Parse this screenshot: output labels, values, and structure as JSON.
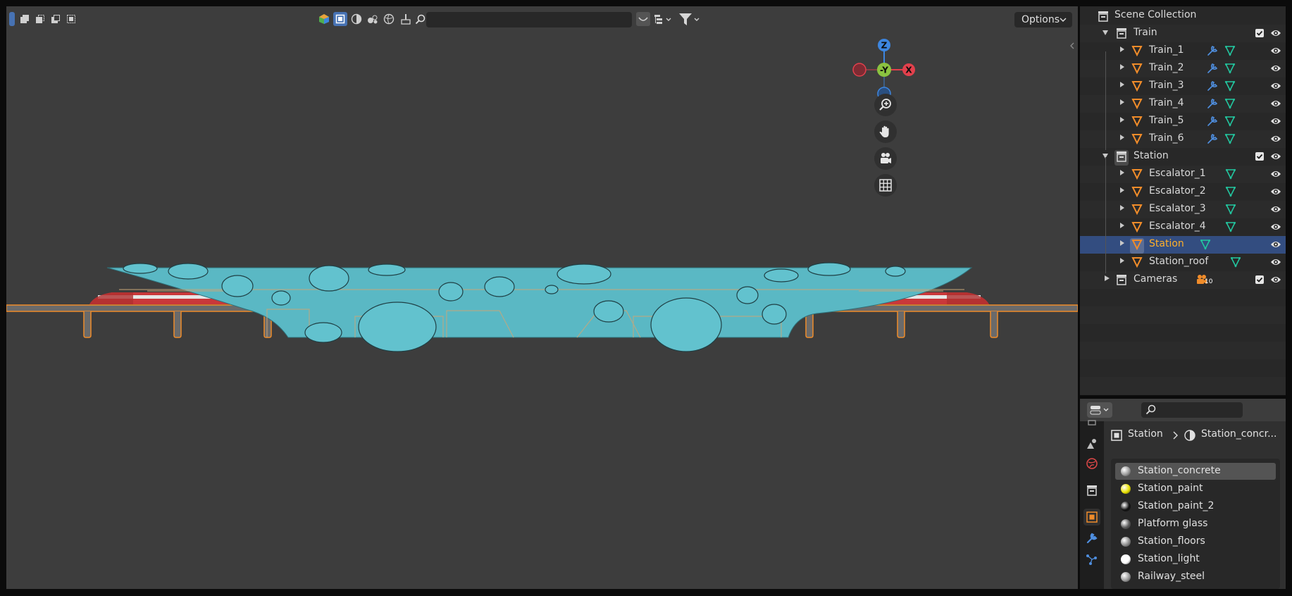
{
  "viewport": {
    "header": {
      "options_label": "Options",
      "icons": [
        "select-box-icon",
        "mode-set-icon",
        "mode-extend-icon",
        "mode-subtract-icon",
        "mode-intersect-icon",
        "object-type-visibility-icon",
        "restrict-select-icon",
        "viewport-shading-icon",
        "render-shading-icon",
        "world-shading-icon",
        "paint-icon",
        "search-icon",
        "curve-icon",
        "hierarchy-icon",
        "filter-icon"
      ]
    },
    "navigation_gizmo": {
      "axis_z": "Z",
      "axis_neg_y": "-Y",
      "axis_x": "X",
      "colors": {
        "x": "#e2404c",
        "y": "#8bc340",
        "z": "#3d86e0"
      }
    },
    "nav_buttons": [
      "zoom-icon",
      "pan-hand-icon",
      "camera-view-icon",
      "ortho-grid-icon"
    ]
  },
  "outliner": {
    "scene_collection": "Scene Collection",
    "rows": [
      {
        "label": "Train",
        "kind": "collection",
        "depth": 1,
        "expanded": true
      },
      {
        "label": "Train_1",
        "kind": "mesh",
        "depth": 2,
        "modifier": true
      },
      {
        "label": "Train_2",
        "kind": "mesh",
        "depth": 2,
        "modifier": true
      },
      {
        "label": "Train_3",
        "kind": "mesh",
        "depth": 2,
        "modifier": true
      },
      {
        "label": "Train_4",
        "kind": "mesh",
        "depth": 2,
        "modifier": true
      },
      {
        "label": "Train_5",
        "kind": "mesh",
        "depth": 2,
        "modifier": true
      },
      {
        "label": "Train_6",
        "kind": "mesh",
        "depth": 2,
        "modifier": true
      },
      {
        "label": "Station",
        "kind": "collection",
        "depth": 1,
        "expanded": true
      },
      {
        "label": "Escalator_1",
        "kind": "mesh",
        "depth": 2,
        "modifier": false
      },
      {
        "label": "Escalator_2",
        "kind": "mesh",
        "depth": 2,
        "modifier": false
      },
      {
        "label": "Escalator_3",
        "kind": "mesh",
        "depth": 2,
        "modifier": false
      },
      {
        "label": "Escalator_4",
        "kind": "mesh",
        "depth": 2,
        "modifier": false
      },
      {
        "label": "Station",
        "kind": "mesh",
        "depth": 2,
        "modifier": false,
        "selected": true
      },
      {
        "label": "Station_roof",
        "kind": "mesh",
        "depth": 2,
        "modifier": false
      },
      {
        "label": "Cameras",
        "kind": "collection",
        "depth": 1,
        "expanded": false,
        "camera_count": "10"
      }
    ]
  },
  "properties": {
    "breadcrumb": {
      "object": "Station",
      "material": "Station_concr..."
    },
    "tabs": [
      "tool-icon",
      "render-icon",
      "output-icon",
      "view-layer-icon",
      "scene-icon",
      "world-icon",
      "collection-icon",
      "object-icon",
      "modifier-icon",
      "particles-icon"
    ],
    "materials": [
      {
        "name": "Station_concrete",
        "ball_color": "#9a9a9a",
        "active": true
      },
      {
        "name": "Station_paint",
        "ball_color": "#e8e000"
      },
      {
        "name": "Station_paint_2",
        "ball_color": "#111111"
      },
      {
        "name": "Platform glass",
        "ball_color": "#5a5a5a"
      },
      {
        "name": "Station_floors",
        "ball_color": "#8a8a8a"
      },
      {
        "name": "Station_light",
        "ball_color": "#ffffff"
      },
      {
        "name": "Railway_steel",
        "ball_color": "#9a9a9a"
      }
    ]
  }
}
